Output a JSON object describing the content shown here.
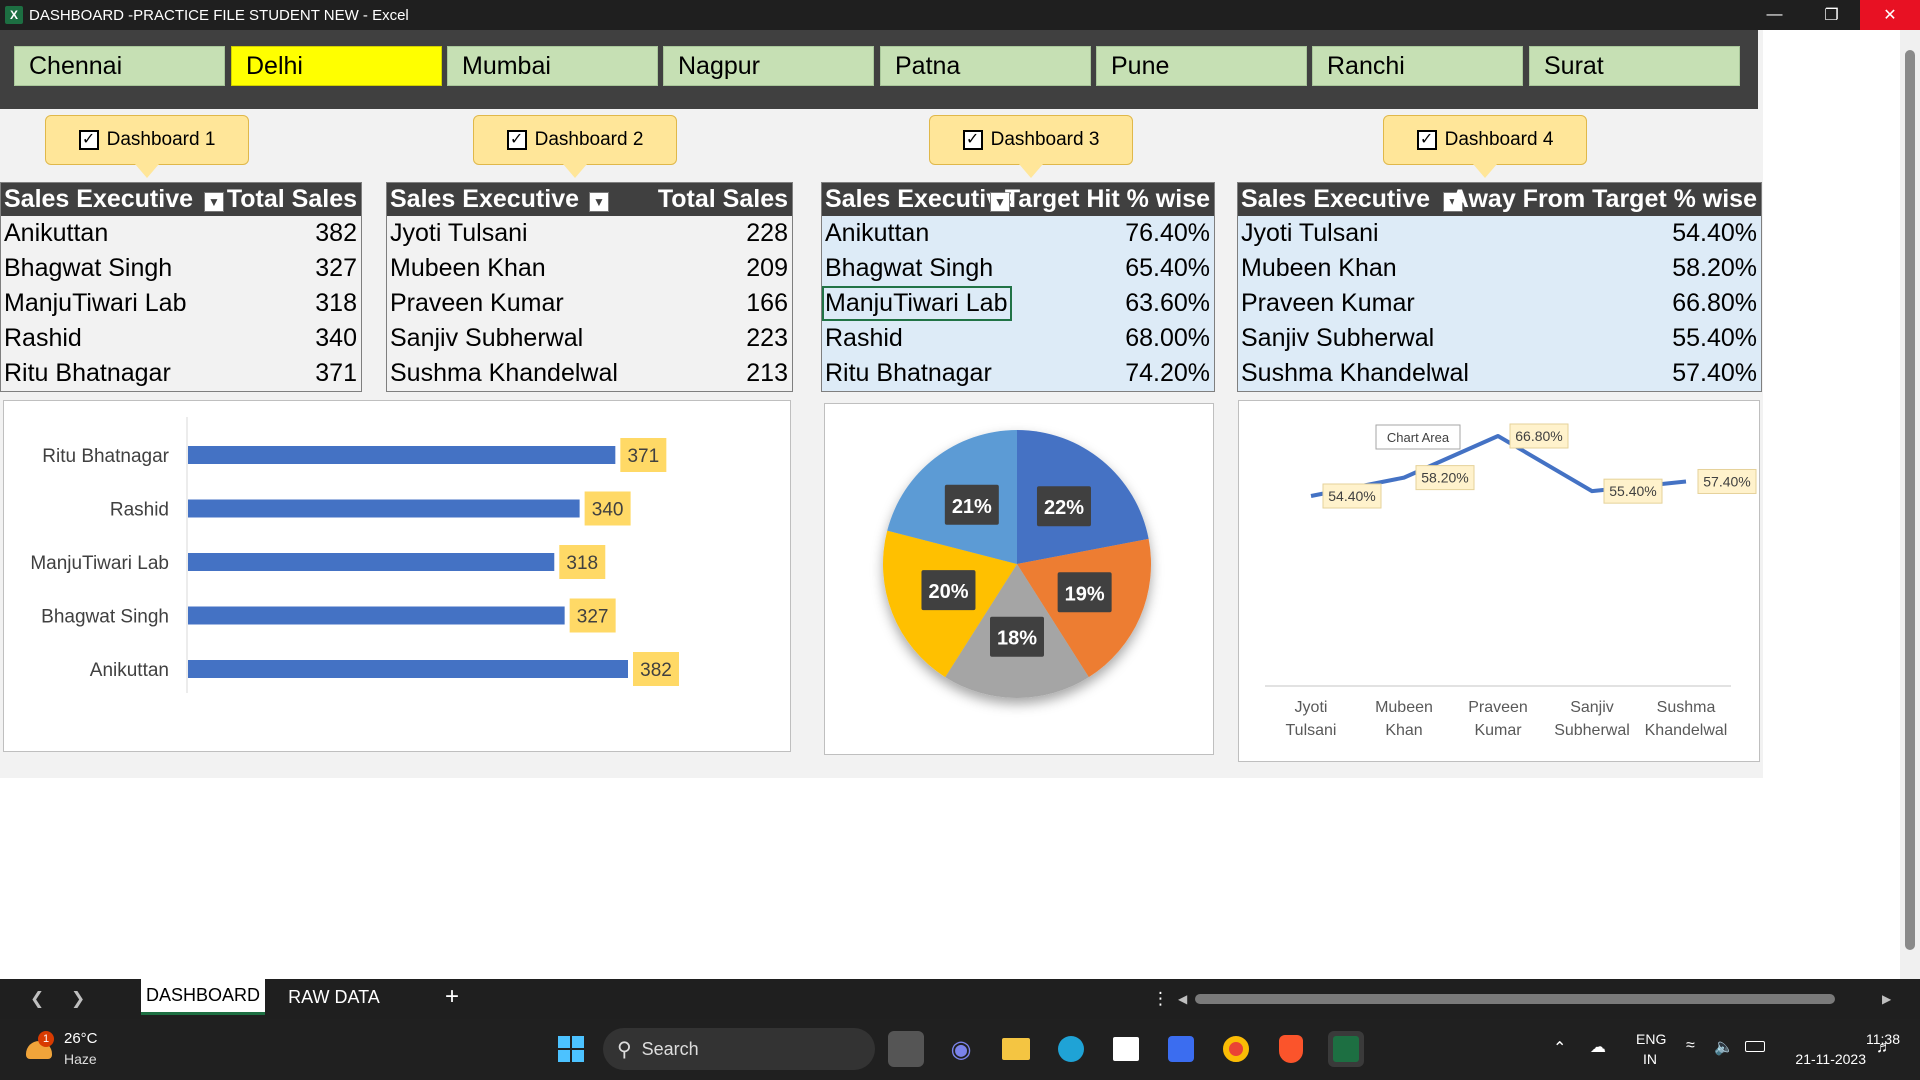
{
  "window": {
    "title": "DASHBOARD -PRACTICE FILE STUDENT NEW  -  Excel",
    "app_icon": "X"
  },
  "slicer": {
    "items": [
      "Chennai",
      "Delhi",
      "Mumbai",
      "Nagpur",
      "Patna",
      "Pune",
      "Ranchi",
      "Surat"
    ],
    "selected": "Delhi"
  },
  "callouts": [
    "Dashboard 1",
    "Dashboard 2",
    "Dashboard 3",
    "Dashboard 4"
  ],
  "table1": {
    "col1": "Sales Executive",
    "col2": "Total Sales",
    "rows": [
      [
        "Anikuttan",
        "382"
      ],
      [
        "Bhagwat Singh",
        "327"
      ],
      [
        "ManjuTiwari Lab",
        "318"
      ],
      [
        "Rashid",
        "340"
      ],
      [
        "Ritu Bhatnagar",
        "371"
      ]
    ]
  },
  "table2": {
    "col1": "Sales Executive",
    "col2": "Total Sales",
    "rows": [
      [
        "Jyoti Tulsani",
        "228"
      ],
      [
        "Mubeen Khan",
        "209"
      ],
      [
        "Praveen Kumar",
        "166"
      ],
      [
        "Sanjiv Subherwal",
        "223"
      ],
      [
        "Sushma Khandelwal",
        "213"
      ]
    ]
  },
  "table3": {
    "col1": "Sales Executive",
    "col2": "Target Hit % wise",
    "rows": [
      [
        "Anikuttan",
        "76.40%"
      ],
      [
        "Bhagwat Singh",
        "65.40%"
      ],
      [
        "ManjuTiwari Lab",
        "63.60%"
      ],
      [
        "Rashid",
        "68.00%"
      ],
      [
        "Ritu Bhatnagar",
        "74.20%"
      ]
    ]
  },
  "table4": {
    "col1": "Sales Executive",
    "col2": "Away From Target % wise",
    "rows": [
      [
        "Jyoti Tulsani",
        "54.40%"
      ],
      [
        "Mubeen Khan",
        "58.20%"
      ],
      [
        "Praveen Kumar",
        "66.80%"
      ],
      [
        "Sanjiv Subherwal",
        "55.40%"
      ],
      [
        "Sushma Khandelwal",
        "57.40%"
      ]
    ]
  },
  "chart_data": [
    {
      "type": "bar",
      "orientation": "horizontal",
      "categories": [
        "Ritu Bhatnagar",
        "Rashid",
        "ManjuTiwari Lab",
        "Bhagwat Singh",
        "Anikuttan"
      ],
      "values": [
        371,
        340,
        318,
        327,
        382
      ],
      "labels": [
        "371",
        "340",
        "318",
        "327",
        "382"
      ],
      "color": "#4472c4"
    },
    {
      "type": "pie",
      "slices": [
        {
          "value": 22,
          "label": "22%",
          "color": "#4472c4"
        },
        {
          "value": 19,
          "label": "19%",
          "color": "#ed7d31"
        },
        {
          "value": 18,
          "label": "18%",
          "color": "#a5a5a5"
        },
        {
          "value": 20,
          "label": "20%",
          "color": "#ffc000"
        },
        {
          "value": 21,
          "label": "21%",
          "color": "#5b9bd5"
        }
      ]
    },
    {
      "type": "line",
      "categories": [
        "Jyoti Tulsani",
        "Mubeen Khan",
        "Praveen Kumar",
        "Sanjiv Subherwal",
        "Sushma Khandelwal"
      ],
      "values": [
        54.4,
        58.2,
        66.8,
        55.4,
        57.4
      ],
      "labels": [
        "54.40%",
        "58.20%",
        "66.80%",
        "55.40%",
        "57.40%"
      ],
      "tooltip": "Chart Area",
      "color": "#4472c4"
    }
  ],
  "sheet_tabs": {
    "tabs": [
      "DASHBOARD",
      "RAW DATA"
    ],
    "active": "DASHBOARD",
    "add": "+"
  },
  "taskbar": {
    "weather_temp": "26°C",
    "weather_desc": "Haze",
    "weather_badge": "1",
    "search_label": "Search",
    "lang": "ENG",
    "region": "IN",
    "time": "11:38",
    "date": "21-11-2023"
  }
}
